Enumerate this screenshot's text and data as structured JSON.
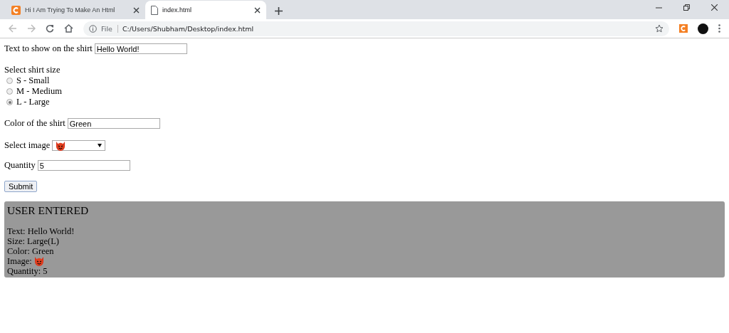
{
  "browser": {
    "tabs": [
      {
        "title": "Hi I Am Trying To Make An Html",
        "selected": false,
        "kind": "site"
      },
      {
        "title": "index.html",
        "selected": true,
        "kind": "file"
      }
    ],
    "address": {
      "scheme": "File",
      "url": "C:/Users/Shubham/Desktop/index.html"
    }
  },
  "form": {
    "text_label": "Text to show on the shirt",
    "text_value": "Hello World!",
    "size_label": "Select shirt size",
    "sizes": [
      {
        "label": "S - Small",
        "selected": false
      },
      {
        "label": "M - Medium",
        "selected": false
      },
      {
        "label": "L - Large",
        "selected": true
      }
    ],
    "color_label": "Color of the shirt",
    "color_value": "Green",
    "image_label": "Select image",
    "quantity_label": "Quantity",
    "quantity_value": "5",
    "submit": "Submit"
  },
  "result": {
    "title": "USER ENTERED",
    "lines": [
      {
        "text": "Text: Hello World!",
        "kind": "text"
      },
      {
        "text": "Size: Large(L)",
        "kind": "text"
      },
      {
        "text": "Color: Green",
        "kind": "text"
      },
      {
        "text": "Image:",
        "kind": "image"
      },
      {
        "text": "Quantity: 5",
        "kind": "text"
      }
    ]
  }
}
